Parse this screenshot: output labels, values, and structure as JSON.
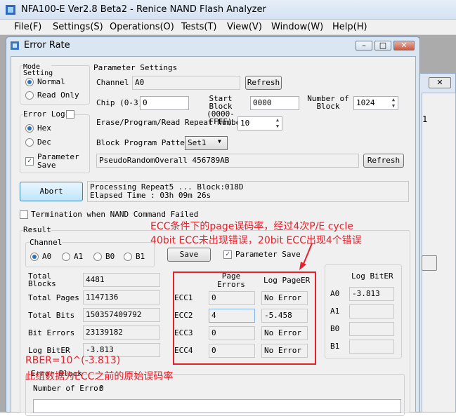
{
  "app": {
    "title": "NFA100-E Ver2.8 Beta2 - Renice NAND Flash Analyzer"
  },
  "menu": [
    "File(F)",
    "Settings(S)",
    "Operations(O)",
    "Tests(T)",
    "View(V)",
    "Window(W)",
    "Help(H)"
  ],
  "bg_window": {
    "fragment": "1"
  },
  "dialog": {
    "title": "Error Rate",
    "mode_label": "Mode Setting",
    "mode_options": [
      "Normal",
      "Read Only"
    ],
    "error_log_label": "Error Log",
    "error_log_options": [
      "Hex",
      "Dec"
    ],
    "parameter_save_label": "Parameter Save",
    "param_group_label": "Parameter Settings",
    "channel_label": "Channel",
    "channel_value": "A0",
    "refresh_label": "Refresh",
    "chip_label": "Chip (0-3)",
    "chip_value": "0",
    "start_block_label": "Start Block (0000-FFFF)",
    "start_block_value": "0000",
    "num_block_label": "Number of Block",
    "num_block_value": "1024",
    "repeat_label": "Erase/Program/Read Repeat Number",
    "repeat_value": "10",
    "pattern_label": "Block Program Pattern",
    "pattern_value": "Set1",
    "pattern_desc": "PseudoRandomOverall 456789AB",
    "refresh2_label": "Refresh",
    "abort_label": "Abort",
    "status_line1": "Processing Repeat5 ... Block:018D",
    "status_line2": "Elapsed Time : 03h 09m 26s",
    "termination_label": "Termination when NAND Command Failed",
    "result_label": "Result",
    "result_channel_label": "Channel",
    "result_channels": [
      "A0",
      "A1",
      "B0",
      "B1"
    ],
    "save_label": "Save",
    "result_param_save_label": "Parameter Save",
    "stats": [
      {
        "label": "Total Blocks",
        "value": "4481"
      },
      {
        "label": "Total Pages",
        "value": "1147136"
      },
      {
        "label": "Total Bits",
        "value": "150357409792"
      },
      {
        "label": "Bit Errors",
        "value": "23139182"
      },
      {
        "label": "Log BitER",
        "value": "-3.813"
      }
    ],
    "ecc_header_errors": "Page Errors",
    "ecc_header_log": "Log PageER",
    "ecc_rows": [
      {
        "label": "ECC1",
        "errors": "0",
        "log": "No Error"
      },
      {
        "label": "ECC2",
        "errors": "4",
        "log": "-5.458"
      },
      {
        "label": "ECC3",
        "errors": "0",
        "log": "No Error"
      },
      {
        "label": "ECC4",
        "errors": "0",
        "log": "No Error"
      }
    ],
    "biter_header": "Log BitER",
    "biter_rows": [
      {
        "label": "A0",
        "value": "-3.813"
      },
      {
        "label": "A1",
        "value": ""
      },
      {
        "label": "B0",
        "value": ""
      },
      {
        "label": "B1",
        "value": ""
      }
    ],
    "error_block_label": "Error Block",
    "num_error_label": "Number of Error",
    "num_error_value": "0"
  },
  "annotations": {
    "top_line1": "ECC条件下的page误码率，经过4次P/E cycle",
    "top_line2": "40bit ECC未出现错误，20bit ECC出现4个错误",
    "bottom_line1": "RBER=10^(-3.813)",
    "bottom_line2": "此组数据为ECC之前的原始误码率",
    "color": "#e8202a"
  }
}
